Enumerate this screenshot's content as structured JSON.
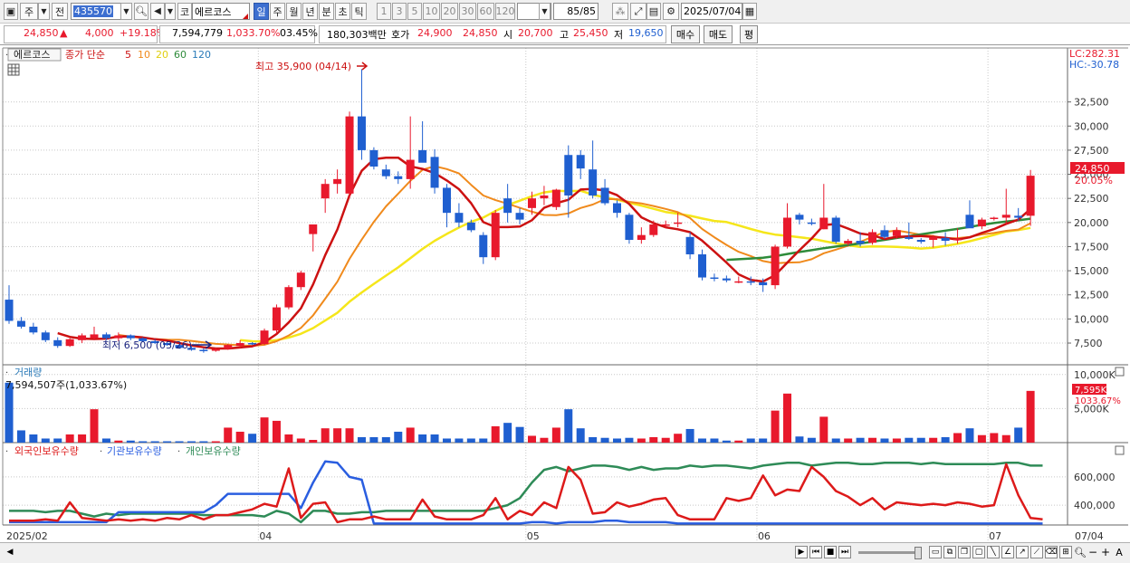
{
  "toolbar": {
    "period_label": "주",
    "prev_label": "전",
    "code": "435570",
    "market_label": "코",
    "name": "에르코스",
    "timeframes": [
      "일",
      "주",
      "월",
      "년",
      "분",
      "초",
      "틱"
    ],
    "active_timeframe": "일",
    "intervals": [
      "1",
      "3",
      "5",
      "10",
      "20",
      "30",
      "60",
      "120"
    ],
    "count": "85/85",
    "date": "2025/07/04"
  },
  "quote": {
    "price": "24,850",
    "change": "4,000",
    "change_pct": "+19.18%",
    "volume": "7,594,779",
    "volume_ratio": "1,033.70%",
    "turnover": "03.45%",
    "amount": "180,303백만",
    "bid_label": "호가",
    "bid": "24,900",
    "ask": "24,850",
    "open_label": "시",
    "open": "20,700",
    "high_label": "고",
    "high": "25,450",
    "low_label": "저",
    "low": "19,650",
    "buy_label": "매수",
    "sell_label": "매도",
    "eval_label": "평"
  },
  "price_panel": {
    "stock_name": "에르코스",
    "ma_title": "종가 단순",
    "ma_periods": [
      "5",
      "10",
      "20",
      "60",
      "120"
    ],
    "lc": "LC:282.31",
    "hc": "HC:-30.78",
    "high_annotation": "최고 35,900 (04/14)",
    "low_annotation": "최저 6,500 (03/26)",
    "current_price_tag": "24,850",
    "current_pct_tag": "20.05%",
    "y_ticks": [
      "32,500",
      "30,000",
      "27,500",
      "25,000",
      "22,500",
      "20,000",
      "17,500",
      "15,000",
      "12,500",
      "10,000",
      "7,500"
    ]
  },
  "volume_panel": {
    "title": "거래량",
    "summary": "7,594,507주(1,033.67%)",
    "y_ticks": [
      "10,000K",
      "5,000K"
    ],
    "current_tag": "7,595K",
    "current_pct": "1033.67%"
  },
  "holding_panel": {
    "legends": [
      "외국인보유수량",
      "기관보유수량",
      "개인보유수량"
    ],
    "y_ticks": [
      "600,000",
      "400,000"
    ]
  },
  "x_axis": {
    "labels": [
      "2025/02",
      "04",
      "05",
      "06",
      "07"
    ],
    "right_label": "07/04"
  },
  "colors": {
    "up": "#e8192c",
    "down": "#1f5fd0",
    "ma5": "#cc1111",
    "ma10": "#f08a1c",
    "ma20": "#f5e61a",
    "ma60": "#2e8b3a",
    "ma120": "#2a7ab8",
    "foreign": "#dd1a1a",
    "institution": "#2a5ee0",
    "individual": "#2e8b57"
  },
  "chart_data": {
    "type": "candlestick",
    "y_axis_range": [
      6000,
      36500
    ],
    "candles": [
      [
        12000,
        13500,
        9500,
        9800
      ],
      [
        9800,
        10200,
        9000,
        9200
      ],
      [
        9200,
        9600,
        8400,
        8600
      ],
      [
        8600,
        8800,
        7600,
        7800
      ],
      [
        7800,
        8100,
        7000,
        7200
      ],
      [
        7200,
        8000,
        7100,
        7900
      ],
      [
        7800,
        8500,
        7500,
        8300
      ],
      [
        8000,
        9200,
        7800,
        8400
      ],
      [
        8400,
        8600,
        7800,
        8000
      ],
      [
        8000,
        8600,
        7700,
        8300
      ],
      [
        8300,
        8400,
        7800,
        8000
      ],
      [
        8000,
        8100,
        7600,
        7700
      ],
      [
        7700,
        7900,
        7400,
        7500
      ],
      [
        7500,
        7600,
        7200,
        7300
      ],
      [
        7300,
        7400,
        6900,
        7000
      ],
      [
        7000,
        7200,
        6700,
        6800
      ],
      [
        6800,
        7000,
        6500,
        6700
      ],
      [
        6700,
        7000,
        6600,
        6900
      ],
      [
        6900,
        7400,
        6800,
        7300
      ],
      [
        7200,
        7800,
        7000,
        7500
      ],
      [
        7500,
        7600,
        7300,
        7400
      ],
      [
        7400,
        9000,
        7300,
        8800
      ],
      [
        8800,
        11500,
        8500,
        11200
      ],
      [
        11200,
        13500,
        11000,
        13300
      ],
      [
        13300,
        15000,
        13000,
        14800
      ],
      [
        18800,
        19500,
        17000,
        19800
      ],
      [
        22500,
        24500,
        21000,
        24000
      ],
      [
        24000,
        25500,
        23000,
        24500
      ],
      [
        23000,
        31500,
        22500,
        31000
      ],
      [
        31000,
        35900,
        26500,
        27500
      ],
      [
        27500,
        27800,
        25500,
        25800
      ],
      [
        25500,
        26000,
        24500,
        24800
      ],
      [
        24800,
        25300,
        24000,
        24500
      ],
      [
        24500,
        31000,
        23500,
        26500
      ],
      [
        27500,
        30500,
        26500,
        26200
      ],
      [
        26800,
        27600,
        23000,
        23600
      ],
      [
        23600,
        24000,
        19500,
        21000
      ],
      [
        21000,
        22000,
        19500,
        20000
      ],
      [
        20000,
        20300,
        19000,
        19200
      ],
      [
        18700,
        19000,
        15700,
        16400
      ],
      [
        16400,
        21300,
        16100,
        21000
      ],
      [
        22500,
        24000,
        20000,
        21000
      ],
      [
        21000,
        21500,
        19800,
        20300
      ],
      [
        21500,
        23200,
        20800,
        22500
      ],
      [
        22500,
        23800,
        21800,
        22800
      ],
      [
        21600,
        23500,
        21300,
        23400
      ],
      [
        27000,
        28000,
        20500,
        22800
      ],
      [
        27000,
        27500,
        24500,
        25600
      ],
      [
        25500,
        28500,
        22500,
        22800
      ],
      [
        23600,
        24500,
        21800,
        22000
      ],
      [
        22000,
        22300,
        20500,
        21000
      ],
      [
        20800,
        21000,
        17800,
        18200
      ],
      [
        18200,
        19500,
        17800,
        18700
      ],
      [
        18700,
        20200,
        18500,
        19800
      ],
      [
        19800,
        20200,
        19400,
        19800
      ],
      [
        20000,
        21000,
        19500,
        20000
      ],
      [
        18500,
        19000,
        16200,
        16700
      ],
      [
        16700,
        17200,
        14000,
        14300
      ],
      [
        14300,
        14700,
        13900,
        14200
      ],
      [
        14200,
        14500,
        13800,
        14000
      ],
      [
        13900,
        14400,
        13700,
        13900
      ],
      [
        13900,
        14400,
        13500,
        13800
      ],
      [
        13800,
        14200,
        12800,
        13500
      ],
      [
        13500,
        17700,
        13100,
        17500
      ],
      [
        17500,
        22000,
        17300,
        20500
      ],
      [
        20800,
        21000,
        19800,
        20300
      ],
      [
        20000,
        20400,
        19700,
        19900
      ],
      [
        19300,
        24000,
        19300,
        20500
      ],
      [
        20500,
        20700,
        17800,
        18000
      ],
      [
        17800,
        18300,
        17600,
        18100
      ],
      [
        18100,
        19000,
        17500,
        17800
      ],
      [
        17900,
        19300,
        17700,
        19000
      ],
      [
        19200,
        19700,
        18300,
        18500
      ],
      [
        18600,
        19500,
        18300,
        19200
      ],
      [
        18500,
        20000,
        18200,
        18300
      ],
      [
        18200,
        18400,
        17800,
        18000
      ],
      [
        18200,
        18700,
        17400,
        18500
      ],
      [
        18400,
        19000,
        17600,
        18100
      ],
      [
        18300,
        19400,
        17800,
        18300
      ],
      [
        20800,
        22300,
        19600,
        19400
      ],
      [
        19600,
        20500,
        19300,
        20300
      ],
      [
        20400,
        20600,
        20200,
        20500
      ],
      [
        20500,
        23500,
        19800,
        20800
      ],
      [
        20700,
        21500,
        20200,
        20500
      ],
      [
        20700,
        25450,
        19650,
        24850
      ]
    ],
    "volume_k": [
      8800,
      1800,
      1200,
      600,
      600,
      1200,
      1200,
      4900,
      600,
      300,
      300,
      200,
      200,
      200,
      200,
      200,
      200,
      200,
      2200,
      1600,
      1300,
      3700,
      3200,
      1200,
      600,
      400,
      2100,
      2100,
      2100,
      800,
      800,
      800,
      1600,
      2200,
      1200,
      1200,
      600,
      600,
      600,
      600,
      2400,
      2900,
      2300,
      1000,
      700,
      2200,
      4900,
      2100,
      800,
      700,
      600,
      700,
      600,
      800,
      700,
      1300,
      2000,
      600,
      600,
      300,
      300,
      600,
      600,
      4700,
      7200,
      900,
      700,
      3800,
      600,
      600,
      700,
      700,
      600,
      600,
      700,
      700,
      700,
      800,
      1400,
      2100,
      1100,
      1400,
      1100,
      2200,
      7595
    ],
    "foreign_k": [
      290,
      290,
      290,
      300,
      290,
      420,
      310,
      300,
      290,
      300,
      290,
      300,
      290,
      310,
      300,
      330,
      300,
      330,
      330,
      350,
      370,
      410,
      390,
      660,
      310,
      410,
      420,
      280,
      300,
      300,
      320,
      300,
      300,
      300,
      440,
      320,
      300,
      300,
      300,
      330,
      450,
      300,
      360,
      330,
      420,
      380,
      670,
      580,
      340,
      350,
      420,
      390,
      410,
      440,
      450,
      330,
      300,
      300,
      300,
      450,
      430,
      450,
      610,
      470,
      510,
      500,
      670,
      600,
      500,
      460,
      400,
      450,
      370,
      420,
      410,
      400,
      410,
      400,
      420,
      410,
      390,
      400,
      690,
      470,
      310,
      300
    ],
    "institution_k": [
      280,
      280,
      280,
      280,
      280,
      280,
      280,
      280,
      280,
      350,
      350,
      350,
      350,
      350,
      350,
      350,
      350,
      400,
      480,
      480,
      480,
      480,
      480,
      480,
      380,
      560,
      710,
      700,
      600,
      580,
      270,
      270,
      270,
      270,
      270,
      270,
      270,
      270,
      270,
      270,
      270,
      270,
      270,
      280,
      280,
      270,
      280,
      280,
      280,
      290,
      290,
      280,
      280,
      280,
      280,
      270,
      270,
      270,
      270,
      270,
      270,
      270,
      270,
      270,
      270,
      270,
      270,
      270,
      270,
      270,
      270,
      270,
      270,
      270,
      270,
      270,
      270,
      270,
      270,
      270,
      270,
      270,
      270,
      270,
      270,
      270
    ],
    "individual_k": [
      360,
      360,
      360,
      350,
      360,
      360,
      340,
      320,
      340,
      330,
      340,
      340,
      340,
      340,
      340,
      340,
      330,
      330,
      330,
      330,
      330,
      320,
      360,
      340,
      280,
      360,
      360,
      340,
      340,
      350,
      350,
      360,
      360,
      360,
      360,
      360,
      360,
      360,
      360,
      360,
      380,
      400,
      450,
      560,
      650,
      670,
      640,
      660,
      680,
      680,
      670,
      650,
      670,
      650,
      660,
      660,
      680,
      670,
      680,
      680,
      670,
      660,
      680,
      690,
      700,
      700,
      680,
      690,
      700,
      700,
      690,
      690,
      700,
      700,
      700,
      690,
      700,
      690,
      690,
      690,
      690,
      690,
      700,
      700,
      680,
      680
    ]
  }
}
